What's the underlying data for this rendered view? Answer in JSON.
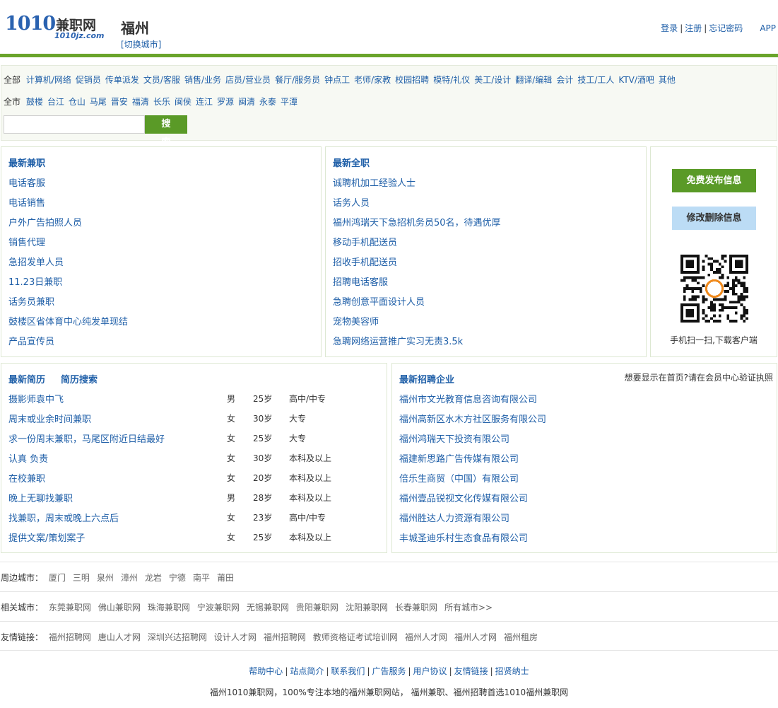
{
  "header": {
    "logo_number": "1010",
    "logo_text": "兼职网",
    "logo_domain": "1010jz.com",
    "city": "福州",
    "switch_city": "[切换城市]",
    "login": "登录",
    "register": "注册",
    "forgot": "忘记密码",
    "app": "APP"
  },
  "categories": {
    "all_label": "全部",
    "items": [
      "计算机/网络",
      "促销员",
      "传单派发",
      "文员/客服",
      "销售/业务",
      "店员/营业员",
      "餐厅/服务员",
      "钟点工",
      "老师/家教",
      "校园招聘",
      "模特/礼仪",
      "美工/设计",
      "翻译/编辑",
      "会计",
      "技工/工人",
      "KTV/酒吧",
      "其他"
    ]
  },
  "districts": {
    "all_label": "全市",
    "items": [
      "鼓楼",
      "台江",
      "仓山",
      "马尾",
      "晋安",
      "福清",
      "长乐",
      "闽侯",
      "连江",
      "罗源",
      "闽清",
      "永泰",
      "平潭"
    ]
  },
  "search": {
    "placeholder": "",
    "button": "搜 索"
  },
  "latest_parttime": {
    "title": "最新兼职",
    "items": [
      "电话客服",
      "电话销售",
      "户外广告拍照人员",
      "销售代理",
      "急招发单人员",
      "11.23日兼职",
      "话务员兼职",
      "鼓楼区省体育中心纯发单现结",
      "产品宣传员"
    ]
  },
  "latest_fulltime": {
    "title": "最新全职",
    "items": [
      "诚聘机加工经验人士",
      "话务人员",
      "福州鸿瑞天下急招机务员50名，待遇优厚",
      "移动手机配送员",
      "招收手机配送员",
      "招聘电话客服",
      "急聘创意平面设计人员",
      "宠物美容师",
      "急聘网络运营推广实习无责3.5k"
    ]
  },
  "side": {
    "publish": "免费发布信息",
    "edit": "修改删除信息",
    "qr_caption": "手机扫一扫,下载客户端"
  },
  "resumes": {
    "title": "最新简历",
    "search_title": "简历搜索",
    "rows": [
      {
        "title": "摄影师袁中飞",
        "gender": "男",
        "age": "25岁",
        "edu": "高中/中专"
      },
      {
        "title": "周末或业余时间兼职",
        "gender": "女",
        "age": "30岁",
        "edu": "大专"
      },
      {
        "title": "求一份周末兼职，马尾区附近日结最好",
        "gender": "女",
        "age": "25岁",
        "edu": "大专"
      },
      {
        "title": "认真 负责",
        "gender": "女",
        "age": "30岁",
        "edu": "本科及以上"
      },
      {
        "title": "在校兼职",
        "gender": "女",
        "age": "20岁",
        "edu": "本科及以上"
      },
      {
        "title": "晚上无聊找兼职",
        "gender": "男",
        "age": "28岁",
        "edu": "本科及以上"
      },
      {
        "title": "找兼职，周末或晚上六点后",
        "gender": "女",
        "age": "23岁",
        "edu": "高中/中专"
      },
      {
        "title": "提供文案/策划案子",
        "gender": "女",
        "age": "25岁",
        "edu": "本科及以上"
      }
    ]
  },
  "companies": {
    "title": "最新招聘企业",
    "note": "想要显示在首页?请在会员中心验证执照",
    "items": [
      "福州市文光教育信息咨询有限公司",
      "福州高新区水木方社区服务有限公司",
      "福州鸿瑞天下投资有限公司",
      "福建新思路广告传媒有限公司",
      "倍乐生商贸（中国）有限公司",
      "福州壹品锐视文化传媒有限公司",
      "福州胜达人力资源有限公司",
      "丰城圣迪乐村生态食品有限公司"
    ]
  },
  "nearby": {
    "label": "周边城市：",
    "items": [
      "厦门",
      "三明",
      "泉州",
      "漳州",
      "龙岩",
      "宁德",
      "南平",
      "莆田"
    ]
  },
  "related": {
    "label": "相关城市：",
    "items": [
      "东莞兼职网",
      "佛山兼职网",
      "珠海兼职网",
      "宁波兼职网",
      "无锡兼职网",
      "贵阳兼职网",
      "沈阳兼职网",
      "长春兼职网",
      "所有城市>>"
    ]
  },
  "friends": {
    "label": "友情链接：",
    "items": [
      "福州招聘网",
      "唐山人才网",
      "深圳兴达招聘网",
      "设计人才网",
      "福州招聘网",
      "教师资格证考试培训网",
      "福州人才网",
      "福州人才网",
      "福州租房"
    ]
  },
  "footer": {
    "links": [
      "帮助中心",
      "站点简介",
      "联系我们",
      "广告服务",
      "用户协议",
      "友情链接",
      "招贤纳士"
    ],
    "text": "福州1010兼职网，100%专注本地的福州兼职网站， 福州兼职、福州招聘首选1010福州兼职网"
  },
  "colors": {
    "accent_green": "#6aa42b",
    "link_blue": "#1f5fa8",
    "edit_button": "#bcdcf5"
  }
}
